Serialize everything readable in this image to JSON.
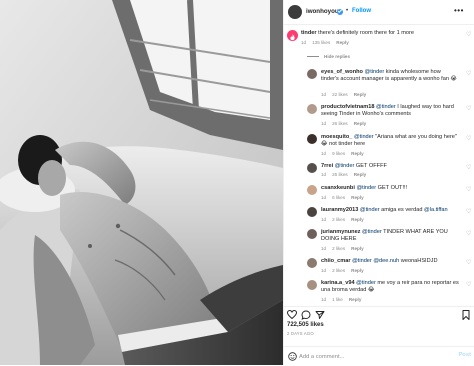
{
  "header": {
    "username": "iwonhoyou",
    "separator": "•",
    "follow_label": "Follow",
    "more_label": "•••"
  },
  "comments": [
    {
      "user": "tinder",
      "text": "there's definitely room there for 1 more",
      "time": "1d",
      "likes": "135 likes",
      "reply": "Reply",
      "avatar_color": "#fe3c72"
    },
    {
      "user": "eyes_of_wonho",
      "mention": "@tinder",
      "text": " kinda wholesome how tinder's account manager is apparently a wonho fan 😭",
      "time": "1d",
      "likes": "22 likes",
      "reply": "Reply",
      "avatar_color": "#7a6a64"
    },
    {
      "user": "productofvietnam18",
      "mention": "@tinder",
      "text": " I laughed way too hard seeing Tinder in Wonho's comments",
      "time": "1d",
      "likes": "26 likes",
      "reply": "Reply",
      "avatar_color": "#b29a8c"
    },
    {
      "user": "moesquito_",
      "mention": "@tinder",
      "text": " \"Ariana what are you doing here\" 😂 not tinder here",
      "time": "1d",
      "likes": "9 likes",
      "reply": "Reply",
      "avatar_color": "#3a2f2a"
    },
    {
      "user": "7rrei",
      "mention": "@tinder",
      "text": " GET OFFFF",
      "time": "1d",
      "likes": "25 likes",
      "reply": "Reply",
      "avatar_color": "#55504c"
    },
    {
      "user": "csanxkeunbi",
      "mention": "@tinder",
      "text": " GET OUT!!!",
      "time": "1d",
      "likes": "6 likes",
      "reply": "Reply",
      "avatar_color": "#c7a48a"
    },
    {
      "user": "lauranmy2013",
      "mention": "@tinder",
      "text": " amiga es verdad ",
      "mention2": "@la.tiffan",
      "time": "1d",
      "likes": "2 likes",
      "reply": "Reply",
      "avatar_color": "#4a4340"
    },
    {
      "user": "jurianmynunez",
      "mention": "@tinder",
      "text": " TINDER WHAT ARE YOU DOING HERE",
      "time": "1d",
      "likes": "2 likes",
      "reply": "Reply",
      "avatar_color": "#6d5f5a"
    },
    {
      "user": "chiio_cmar",
      "mention": "@tinder",
      "text": " ",
      "mention2": "@dee.nuh",
      "text2": " weonaHSIDJD",
      "time": "1d",
      "likes": "2 likes",
      "reply": "Reply",
      "avatar_color": "#8a7a70"
    },
    {
      "user": "karina.a_v94",
      "mention": "@tinder",
      "text": " me voy a reir para no reportar es una broma verdad 😂",
      "time": "1d",
      "likes": "1 like",
      "reply": "Reply",
      "avatar_color": "#a89080"
    }
  ],
  "hide_replies": "Hide replies",
  "footer": {
    "likes": "722,505 likes",
    "ago": "2 DAYS AGO",
    "comment_placeholder": "Add a comment...",
    "post_label": "Post"
  },
  "colors": {
    "accent": "#0095f6",
    "tinder": "#fe3c72",
    "muted": "#8e8e8e"
  },
  "icons": [
    "heart-icon",
    "comment-icon",
    "share-icon",
    "bookmark-icon",
    "emoji-icon",
    "verified-icon"
  ]
}
